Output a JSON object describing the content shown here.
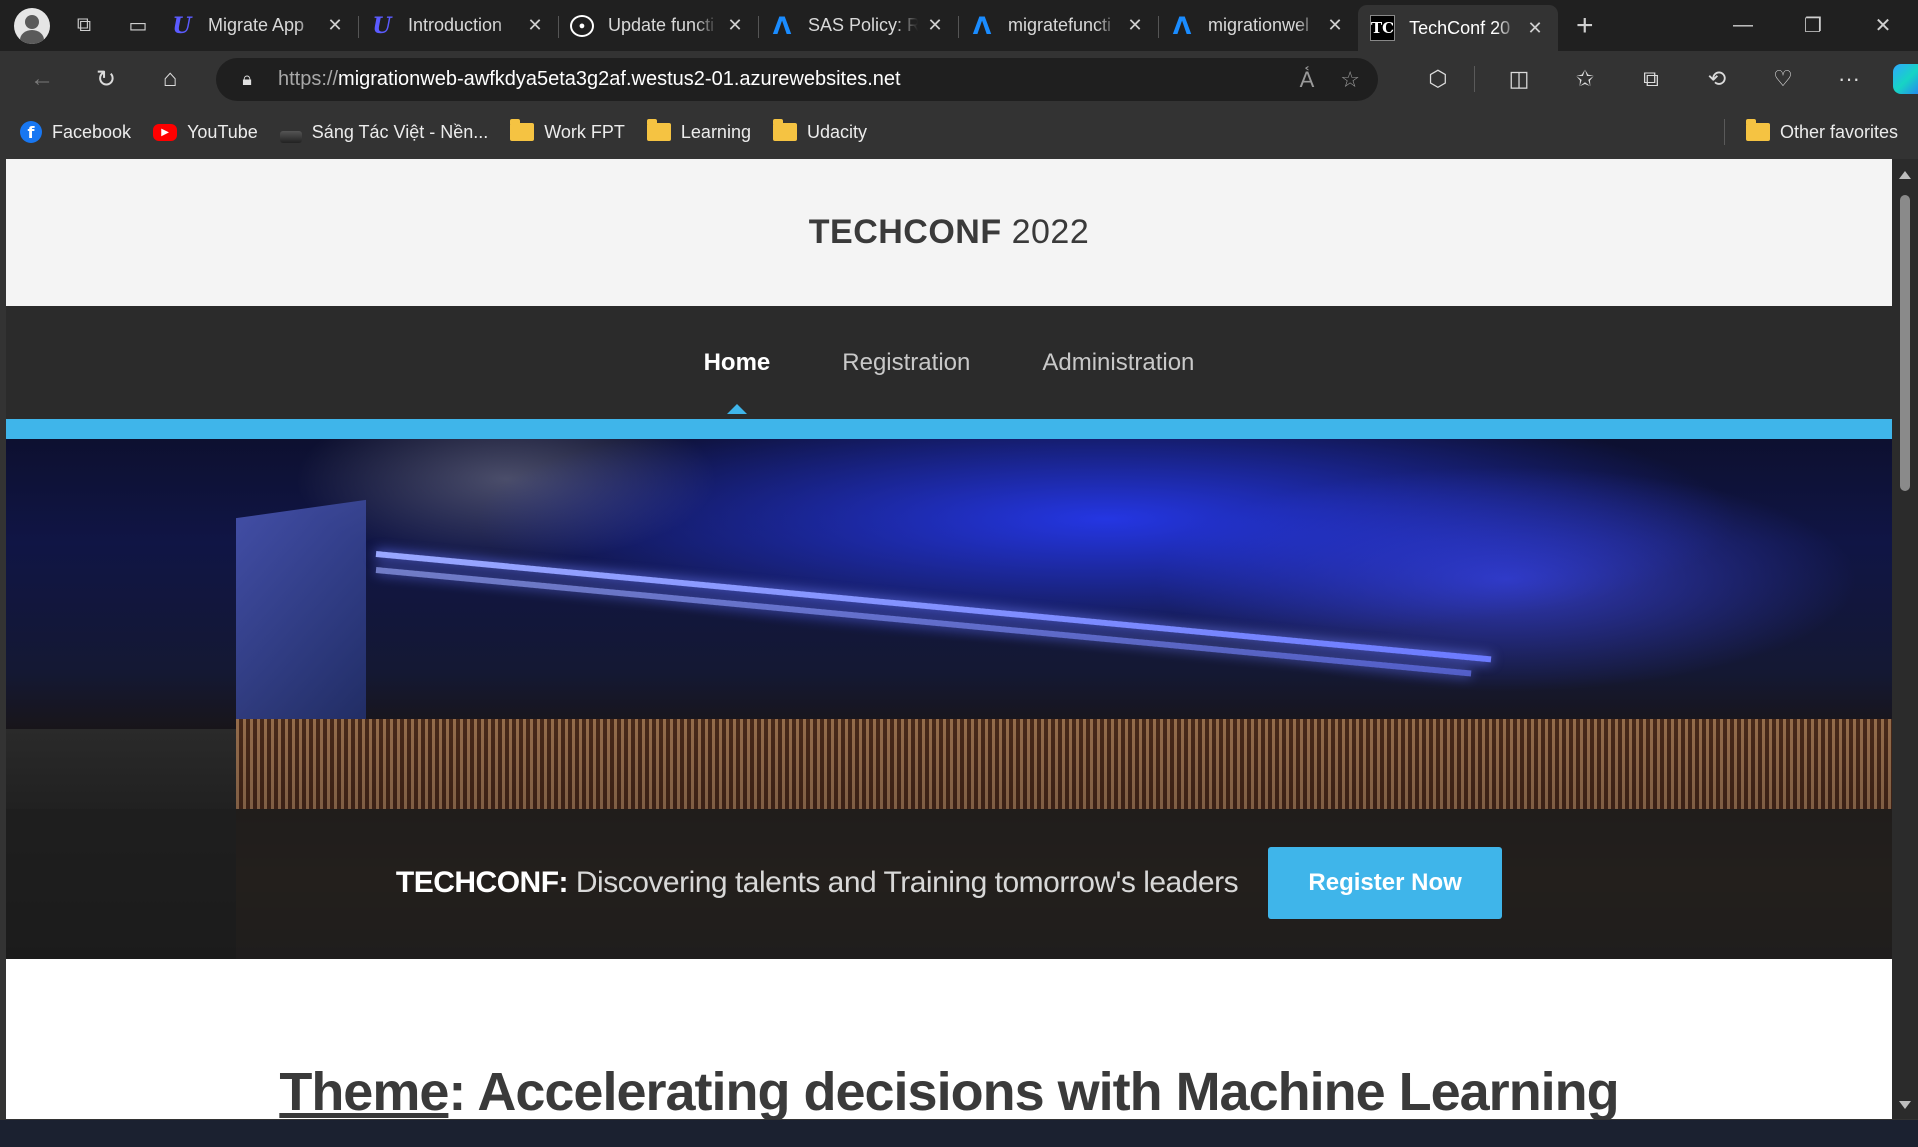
{
  "browser": {
    "tabs": [
      {
        "title": "Migrate App",
        "icon": "udacity-icon",
        "active": false
      },
      {
        "title": "Introduction",
        "icon": "udacity-icon",
        "active": false
      },
      {
        "title": "Update functi",
        "icon": "github-icon",
        "active": false
      },
      {
        "title": "SAS Policy: R",
        "icon": "azure-icon",
        "active": false
      },
      {
        "title": "migratefuncti",
        "icon": "azure-icon",
        "active": false
      },
      {
        "title": "migrationwel",
        "icon": "azure-icon",
        "active": false
      },
      {
        "title": "TechConf 20",
        "icon": "techconf-icon",
        "active": true
      }
    ],
    "tab_icon_text": {
      "techconf": "TC"
    },
    "address": {
      "protocol": "https://",
      "host": "migrationweb-awfkdya5eta3g2af.westus2-01.azurewebsites.net"
    },
    "favorites": [
      {
        "label": "Facebook",
        "icon": "facebook-icon"
      },
      {
        "label": "YouTube",
        "icon": "youtube-icon"
      },
      {
        "label": "Sáng Tác Việt - Nền...",
        "icon": "site-icon"
      },
      {
        "label": "Work FPT",
        "icon": "folder-icon"
      },
      {
        "label": "Learning",
        "icon": "folder-icon"
      },
      {
        "label": "Udacity",
        "icon": "folder-icon"
      }
    ],
    "other_favorites": "Other favorites"
  },
  "site": {
    "brand_bold": "TECHCONF",
    "brand_year": "2022",
    "nav": [
      {
        "label": "Home",
        "active": true
      },
      {
        "label": "Registration",
        "active": false
      },
      {
        "label": "Administration",
        "active": false
      }
    ],
    "hero": {
      "tagline_bold": "TECHCONF:",
      "tagline_rest": "Discovering talents and Training tomorrow's leaders",
      "cta": "Register Now"
    },
    "theme": {
      "label": "Theme",
      "text": ": Accelerating decisions with Machine Learning"
    }
  },
  "colors": {
    "accent": "#3fb5ea",
    "nav_bg": "#2b2b2b",
    "header_bg": "#f4f4f4",
    "browser_dark": "#202020",
    "browser_toolbar": "#333333"
  }
}
